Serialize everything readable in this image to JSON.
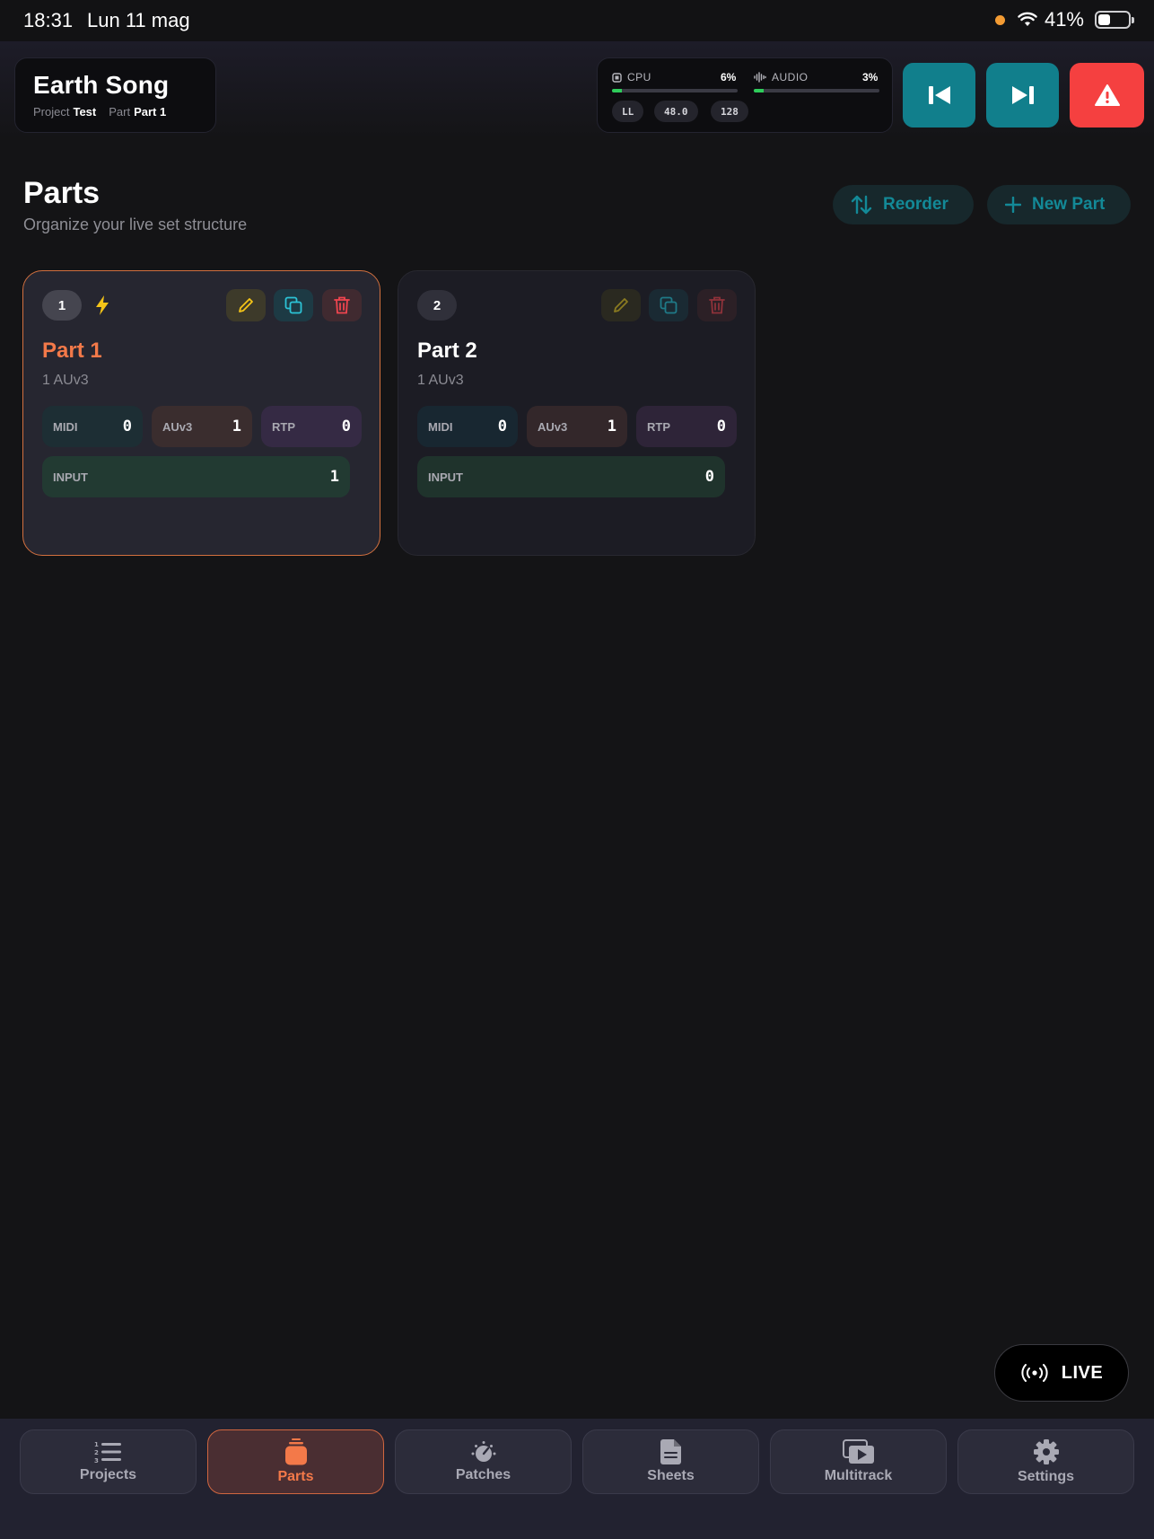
{
  "status_bar": {
    "time": "18:31",
    "date": "Lun 11 mag",
    "battery": "41%",
    "battery_level": 0.41
  },
  "header": {
    "song_title": "Earth Song",
    "project_label": "Project",
    "project_value": "Test",
    "part_label": "Part",
    "part_value": "Part 1"
  },
  "performance": {
    "cpu_label": "CPU",
    "cpu_value": "6%",
    "cpu_level": 0.06,
    "audio_label": "AUDIO",
    "audio_value": "3%",
    "audio_level": 0.03,
    "pills": [
      "LL",
      "48.0",
      "128"
    ]
  },
  "icons": {
    "prev": "skip-previous-icon",
    "next": "skip-next-icon",
    "panic": "warning-icon",
    "reorder": "swap-vertical-icon",
    "new_part": "plus-icon"
  },
  "colors": {
    "accent": "#f37949",
    "teal": "#117f8c",
    "danger": "#f54040",
    "meter": "#2ecc5a"
  },
  "page": {
    "title": "Parts",
    "subtitle": "Organize your live set structure",
    "reorder_label": "Reorder",
    "new_part_label": "New Part"
  },
  "parts": [
    {
      "number": "1",
      "title": "Part 1",
      "subtitle": "1 AUv3",
      "midi_label": "MIDI",
      "midi": "0",
      "auv3_label": "AUv3",
      "auv3": "1",
      "rtp_label": "RTP",
      "rtp": "0",
      "input_label": "INPUT",
      "input": "1",
      "active": true
    },
    {
      "number": "2",
      "title": "Part 2",
      "subtitle": "1 AUv3",
      "midi_label": "MIDI",
      "midi": "0",
      "auv3_label": "AUv3",
      "auv3": "1",
      "rtp_label": "RTP",
      "rtp": "0",
      "input_label": "INPUT",
      "input": "0",
      "active": false
    }
  ],
  "live_label": "LIVE",
  "tabs": [
    {
      "label": "Projects",
      "icon": "numbered-list-icon"
    },
    {
      "label": "Parts",
      "icon": "layers-icon",
      "active": true
    },
    {
      "label": "Patches",
      "icon": "knob-icon"
    },
    {
      "label": "Sheets",
      "icon": "document-icon"
    },
    {
      "label": "Multitrack",
      "icon": "media-play-icon"
    },
    {
      "label": "Settings",
      "icon": "gear-icon"
    }
  ]
}
